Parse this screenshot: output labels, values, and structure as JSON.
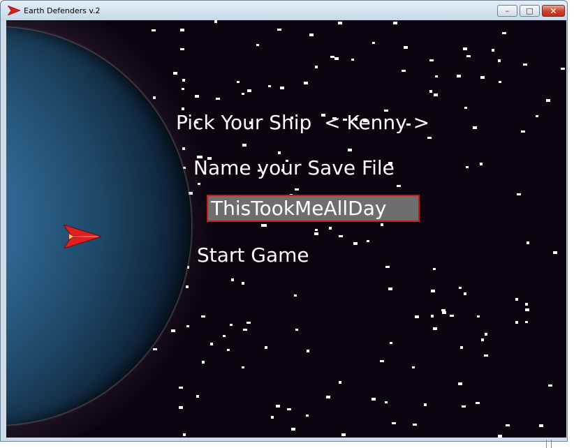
{
  "window": {
    "title": "Earth Defenders v.2",
    "controls": {
      "minimize": "–",
      "maximize": "□",
      "close": "✕"
    }
  },
  "menu": {
    "ship_label": "Pick Your Ship",
    "ship_value": "< Kenny >",
    "save_label": "Name your Save File",
    "save_value": "ThisTookMeAllDay",
    "start_label": "Start Game"
  },
  "colors": {
    "background": "#0b030d",
    "text": "#ffffff",
    "input_fill": "#6e6e6e",
    "input_border": "#c81818",
    "ship": "#e02020"
  },
  "icons": {
    "app": "red-ship-icon",
    "player": "red-ship-icon"
  }
}
